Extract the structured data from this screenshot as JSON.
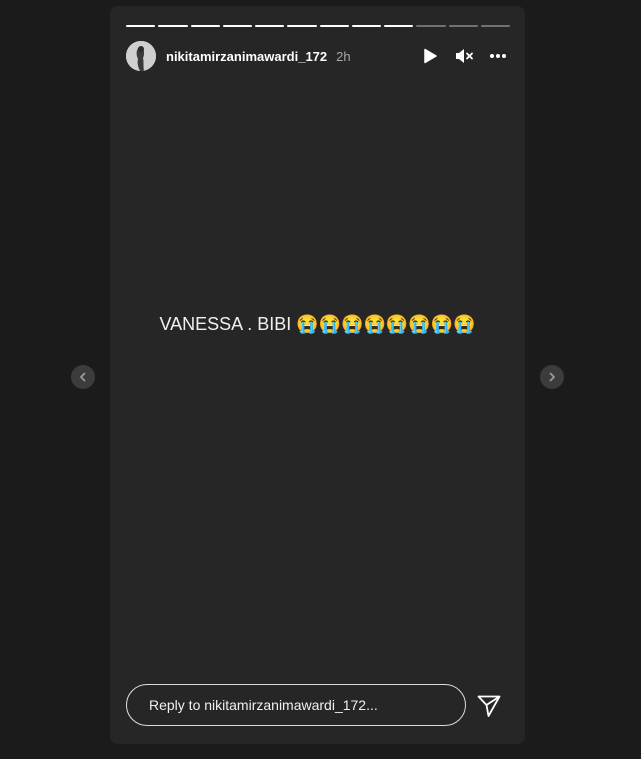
{
  "story": {
    "username": "nikitamirzanimawardi_172",
    "time_ago": "2h",
    "caption": "VANESSA . BIBI 😭😭😭😭😭😭😭😭",
    "progress": {
      "segments": 12,
      "viewed": 9
    }
  },
  "controls": {
    "play_icon": "play-icon",
    "mute_icon": "speaker-muted-icon",
    "more_icon": "more-horizontal-icon"
  },
  "navigation": {
    "prev_icon": "chevron-left-icon",
    "next_icon": "chevron-right-icon"
  },
  "reply": {
    "placeholder": "Reply to nikitamirzanimawardi_172..."
  },
  "colors": {
    "page_background": "#1b1b1b",
    "story_background": "#262626",
    "text": "#ffffff",
    "muted_text": "#a8a8a8"
  }
}
